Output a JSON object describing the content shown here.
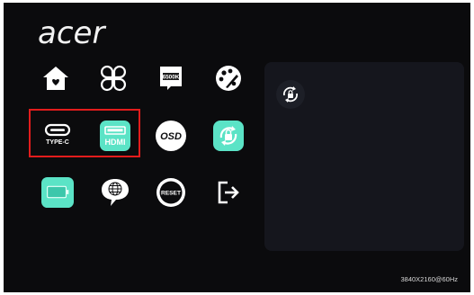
{
  "brand": {
    "logo_text": "acer"
  },
  "menu": {
    "row1": [
      {
        "id": "home",
        "icon": "home-icon"
      },
      {
        "id": "picture-modes",
        "icon": "clover-icon"
      },
      {
        "id": "color-temp",
        "icon": "color-temp-icon",
        "label": "6500K"
      },
      {
        "id": "color",
        "icon": "palette-icon"
      }
    ],
    "row2": [
      {
        "id": "type-c",
        "icon": "type-c-icon",
        "label": "TYPE-C"
      },
      {
        "id": "hdmi",
        "icon": "hdmi-icon",
        "label": "HDMI"
      },
      {
        "id": "osd",
        "icon": "osd-icon",
        "label": "OSD"
      },
      {
        "id": "osd-lock",
        "icon": "rotate-lock-icon"
      }
    ],
    "row3": [
      {
        "id": "battery",
        "icon": "battery-icon"
      },
      {
        "id": "language",
        "icon": "language-icon"
      },
      {
        "id": "reset",
        "icon": "reset-icon",
        "label": "RESET"
      },
      {
        "id": "exit",
        "icon": "exit-icon"
      }
    ]
  },
  "panel": {
    "icon": "rotate-lock-icon"
  },
  "status": {
    "resolution": "3840X2160@60Hz"
  },
  "colors": {
    "accent": "#5be3c6",
    "highlight_border": "#e21c1c",
    "panel_bg": "#15161d"
  }
}
